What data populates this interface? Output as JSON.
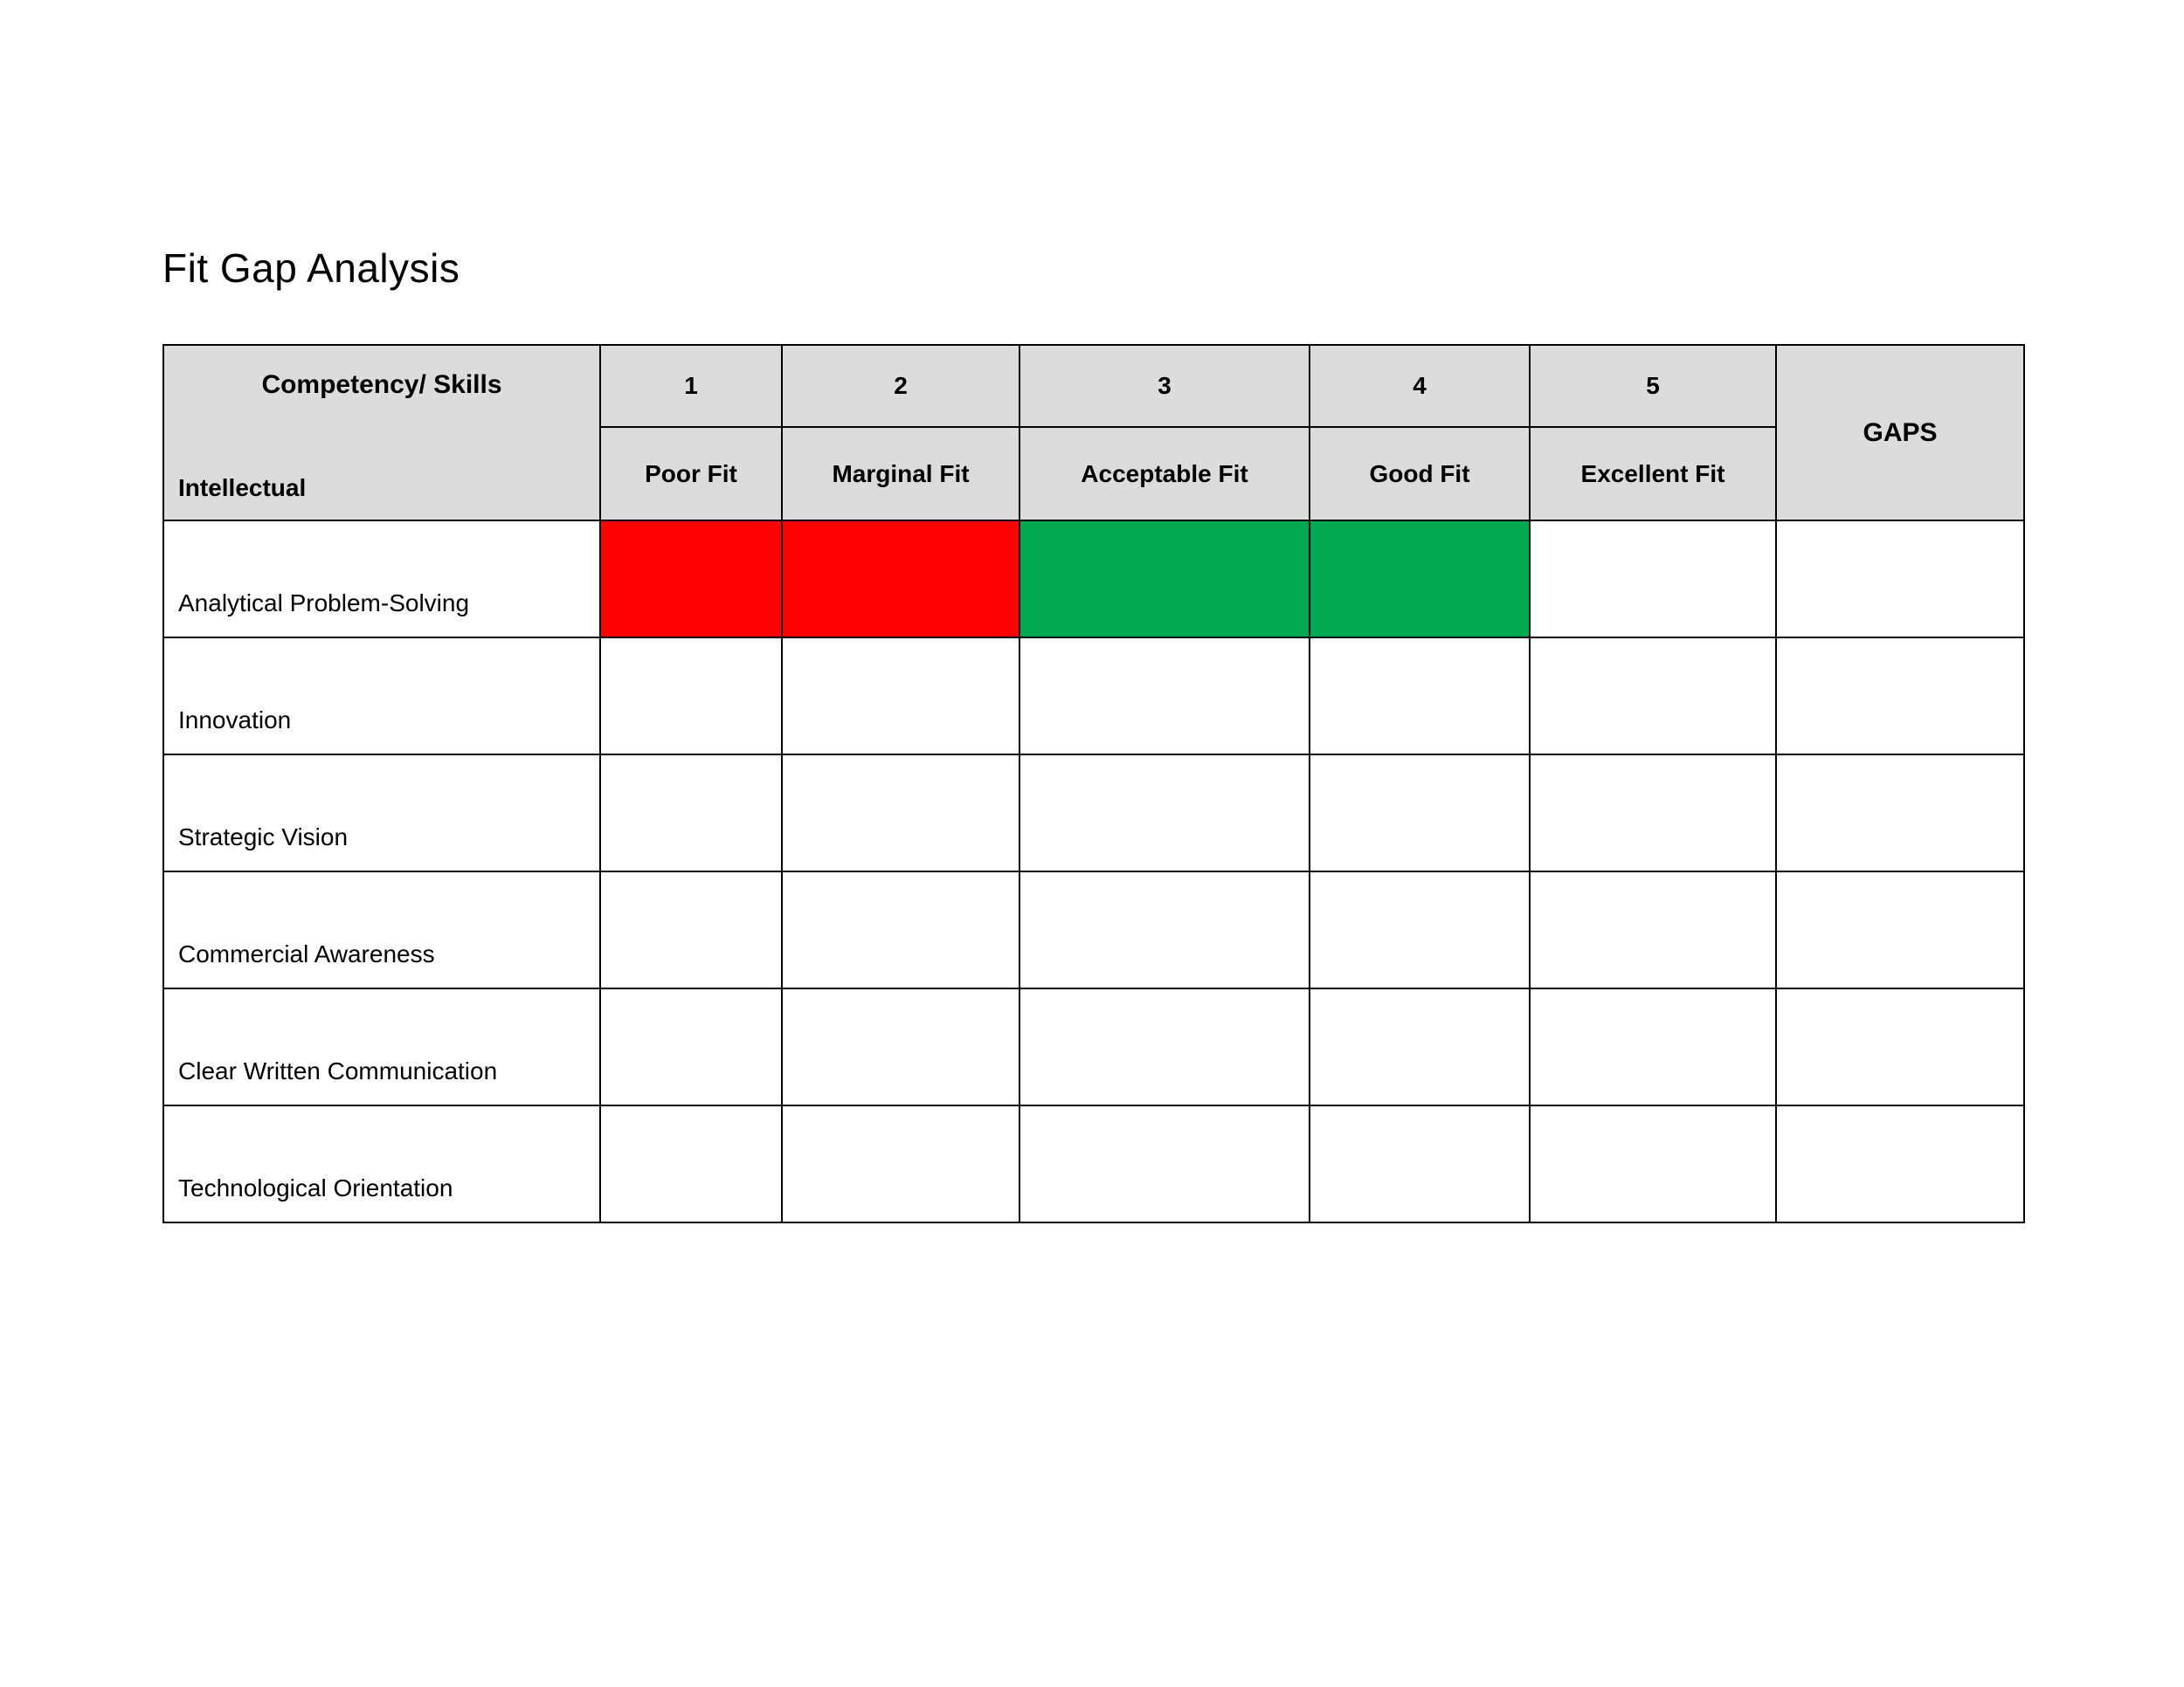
{
  "title": "Fit Gap Analysis",
  "colors": {
    "red": "#ff0000",
    "green": "#00a84f",
    "header_bg": "#dcdcdc"
  },
  "headers": {
    "skills": "Competency/ Skills",
    "gaps": "GAPS",
    "scale": [
      {
        "num": "1",
        "label": "Poor Fit"
      },
      {
        "num": "2",
        "label": "Marginal Fit"
      },
      {
        "num": "3",
        "label": "Acceptable Fit"
      },
      {
        "num": "4",
        "label": "Good Fit"
      },
      {
        "num": "5",
        "label": "Excellent Fit"
      }
    ]
  },
  "category": "Intellectual",
  "rows": [
    {
      "label": "Analytical Problem-Solving",
      "ratings": [
        "red",
        "red",
        "green",
        "green",
        ""
      ],
      "gaps": ""
    },
    {
      "label": "Innovation",
      "ratings": [
        "",
        "",
        "",
        "",
        ""
      ],
      "gaps": ""
    },
    {
      "label": "Strategic Vision",
      "ratings": [
        "",
        "",
        "",
        "",
        ""
      ],
      "gaps": ""
    },
    {
      "label": "Commercial Awareness",
      "ratings": [
        "",
        "",
        "",
        "",
        ""
      ],
      "gaps": ""
    },
    {
      "label": "Clear Written Communication",
      "ratings": [
        "",
        "",
        "",
        "",
        ""
      ],
      "gaps": ""
    },
    {
      "label": "Technological Orientation",
      "ratings": [
        "",
        "",
        "",
        "",
        ""
      ],
      "gaps": ""
    }
  ]
}
